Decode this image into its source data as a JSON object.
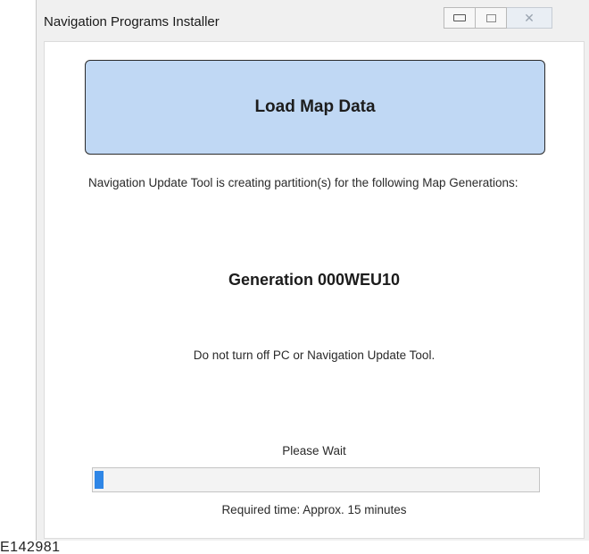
{
  "window": {
    "title": "Navigation Programs Installer",
    "caption_buttons": {
      "minimize_icon": "minimize-icon",
      "maximize_icon": "maximize-icon",
      "close_icon": "close-icon"
    }
  },
  "banner": {
    "title": "Load Map Data",
    "background": "#c0d8f4"
  },
  "status": {
    "message": "Navigation Update Tool is creating partition(s) for the following Map Generations:",
    "generation": "Generation 000WEU10",
    "warning": "Do not turn off PC or Navigation Update Tool."
  },
  "progress": {
    "label": "Please Wait",
    "fraction": 0.02,
    "fill_color": "#2f86e6",
    "required_time": "Required time: Approx. 15 minutes"
  },
  "figure_id": "E142981"
}
